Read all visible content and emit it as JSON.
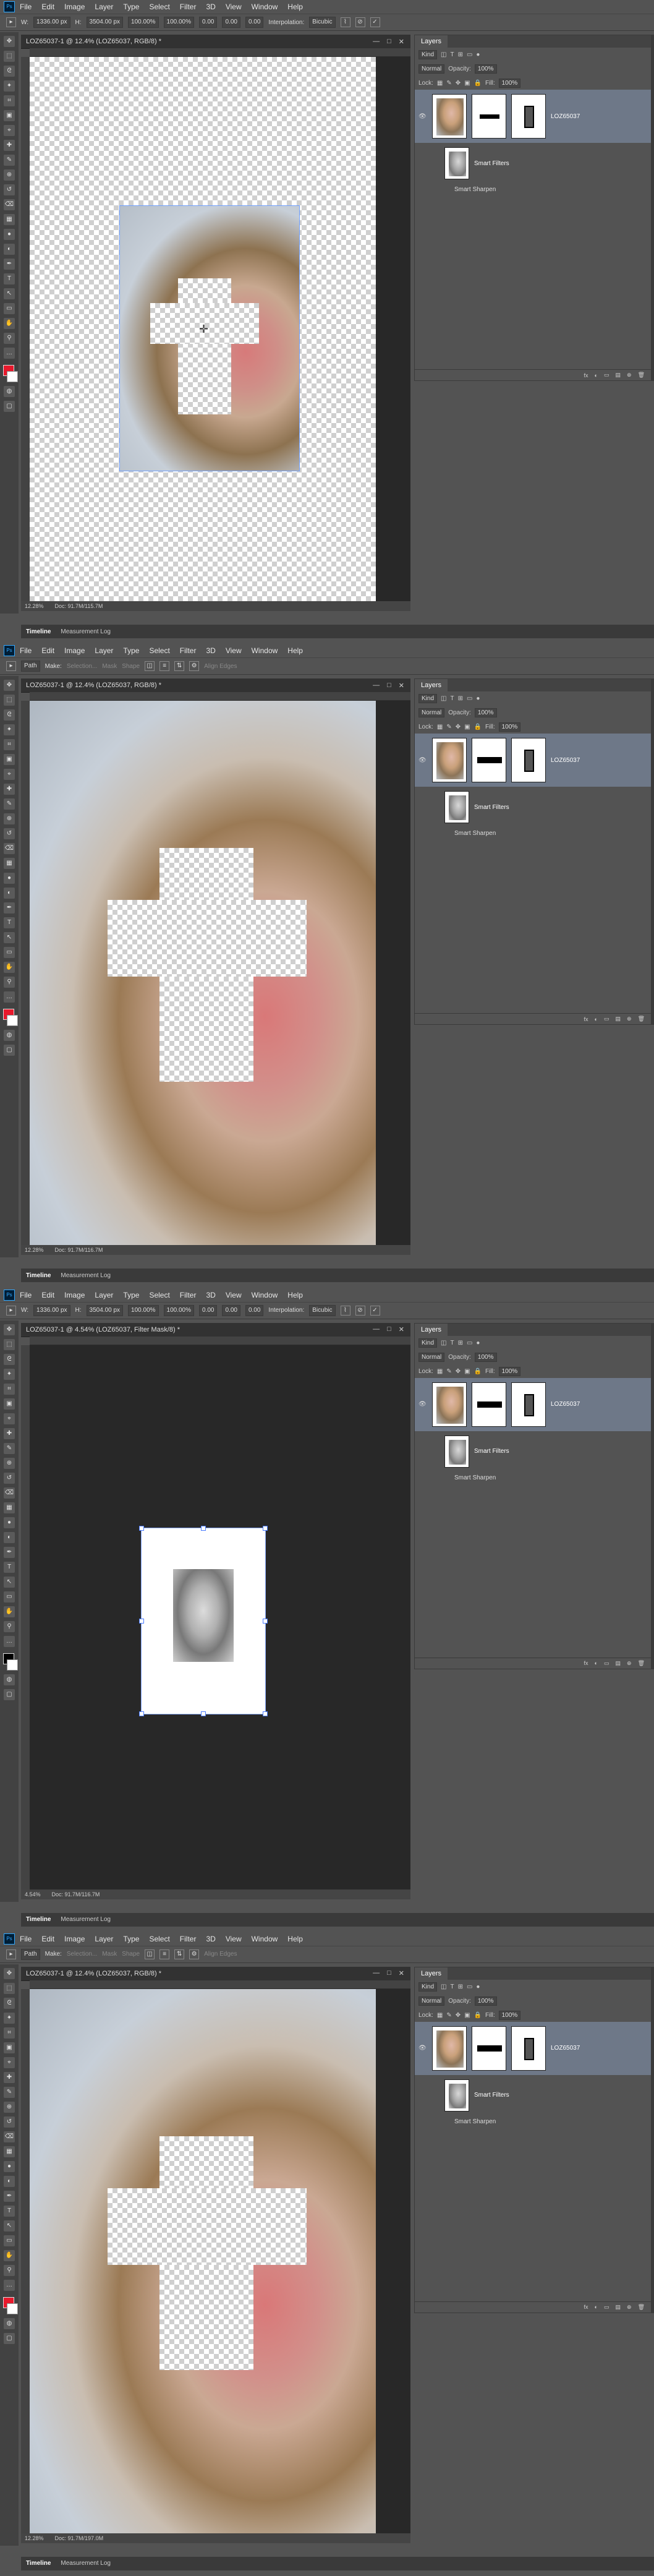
{
  "menu": [
    "File",
    "Edit",
    "Image",
    "Layer",
    "Type",
    "Select",
    "Filter",
    "3D",
    "View",
    "Window",
    "Help"
  ],
  "ps_logo": "Ps",
  "shots": [
    {
      "tab_title": "LOZ65037-1 @ 12.4% (LOZ65037, RGB/8) *",
      "opt": {
        "w_label": "W:",
        "w_val": "1336.00 px",
        "h_label": "H:",
        "h_val": "3504.00 px",
        "pct1": "100.00%",
        "pct2": "100.00%",
        "angle": "0.00",
        "hskew": "0.00",
        "vskew": "0.00",
        "interp_label": "Interpolation:",
        "interp_val": "Bicubic"
      },
      "zoom": "12.28%",
      "doc": "Doc: 91.7M/115.7M",
      "fg": "#e8192c"
    },
    {
      "tab_title": "LOZ65037-1 @ 12.4% (LOZ65037, RGB/8) *",
      "opt": {
        "mode": "Path",
        "make": "Make:",
        "selection": "Selection...",
        "mask": "Mask",
        "shape": "Shape",
        "align": "Align Edges"
      },
      "zoom": "12.28%",
      "doc": "Doc: 91.7M/116.7M",
      "fg": "#e8192c"
    },
    {
      "tab_title": "LOZ65037-1 @ 4.54% (LOZ65037, Filter Mask/8) *",
      "opt": {
        "w_label": "W:",
        "w_val": "1336.00 px",
        "h_label": "H:",
        "h_val": "3504.00 px",
        "pct1": "100.00%",
        "pct2": "100.00%",
        "angle": "0.00",
        "hskew": "0.00",
        "vskew": "0.00",
        "interp_label": "Interpolation:",
        "interp_val": "Bicubic"
      },
      "zoom": "4.54%",
      "doc": "Doc: 91.7M/116.7M",
      "fg": "#000000"
    },
    {
      "tab_title": "LOZ65037-1 @ 12.4% (LOZ65037, RGB/8) *",
      "opt": {
        "mode": "Path",
        "make": "Make:",
        "selection": "Selection...",
        "mask": "Mask",
        "shape": "Shape",
        "align": "Align Edges"
      },
      "zoom": "12.28%",
      "doc": "Doc: 91.7M/197.0M",
      "fg": "#e8192c"
    }
  ],
  "panel": {
    "tab": "Layers",
    "kind": "Kind",
    "blend": "Normal",
    "opacity_label": "Opacity:",
    "opacity": "100%",
    "lock_label": "Lock:",
    "fill_label": "Fill:",
    "fill": "100%",
    "layer_name": "LOZ65037",
    "smart_filters": "Smart Filters",
    "smart_sharpen": "Smart Sharpen",
    "footer": [
      "fx",
      "◐",
      "▭",
      "▤",
      "⊕",
      "🗑"
    ]
  },
  "bottom_tabs": [
    "Timeline",
    "Measurement Log"
  ],
  "window_buttons": [
    "—",
    "□",
    "✕"
  ]
}
